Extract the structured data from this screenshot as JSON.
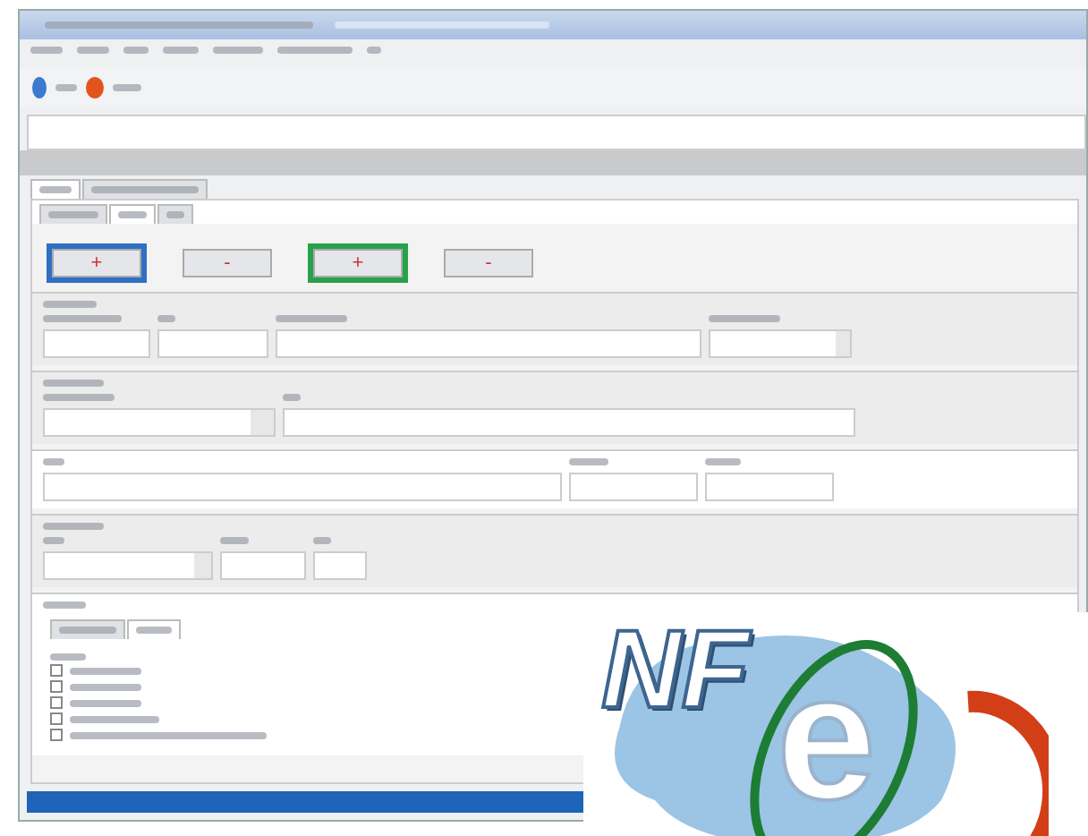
{
  "tabs": [
    {
      "selected": true
    },
    {
      "selected": false
    }
  ],
  "subtabs": [
    {
      "selected": false
    },
    {
      "selected": true
    },
    {
      "selected": false
    }
  ],
  "action_buttons": [
    {
      "glyph": "+",
      "color": "#2f6fc4"
    },
    {
      "glyph": "-"
    },
    {
      "glyph": "+",
      "color": "#27a24a"
    },
    {
      "glyph": "-"
    }
  ],
  "checkboxes": [
    {
      "checked": false
    },
    {
      "checked": false
    },
    {
      "checked": false
    },
    {
      "checked": false
    },
    {
      "checked": false
    }
  ],
  "logo": {
    "left": "NF",
    "center": "e"
  }
}
